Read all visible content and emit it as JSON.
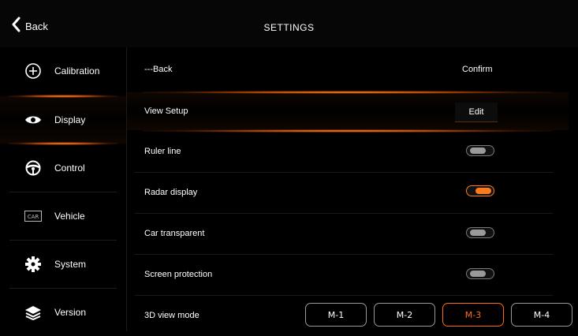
{
  "header": {
    "back_label": "Back",
    "title": "SETTINGS"
  },
  "sidebar": {
    "items": [
      {
        "label": "Calibration",
        "icon": "plus-circle-icon",
        "active": false
      },
      {
        "label": "Display",
        "icon": "eye-icon",
        "active": true
      },
      {
        "label": "Control",
        "icon": "steering-wheel-icon",
        "active": false
      },
      {
        "label": "Vehicle",
        "icon": "car-badge-icon",
        "active": false
      },
      {
        "label": "System",
        "icon": "gear-icon",
        "active": false
      },
      {
        "label": "Version",
        "icon": "layers-icon",
        "active": false
      }
    ],
    "car_badge_text": "CAR"
  },
  "main": {
    "back_row": {
      "label": "---Back",
      "action": "Confirm"
    },
    "view_setup": {
      "label": "View Setup",
      "action": "Edit"
    },
    "toggles": [
      {
        "label": "Ruler line",
        "on": false
      },
      {
        "label": "Radar display",
        "on": true
      },
      {
        "label": "Car transparent",
        "on": false
      },
      {
        "label": "Screen protection",
        "on": false
      }
    ],
    "mode_row": {
      "label": "3D view mode",
      "options": [
        "M-1",
        "M-2",
        "M-3",
        "M-4"
      ],
      "selected": "M-3"
    }
  },
  "colors": {
    "accent": "#ff7a1a",
    "background": "#000000",
    "toggle_off": "#7a7a7a"
  }
}
